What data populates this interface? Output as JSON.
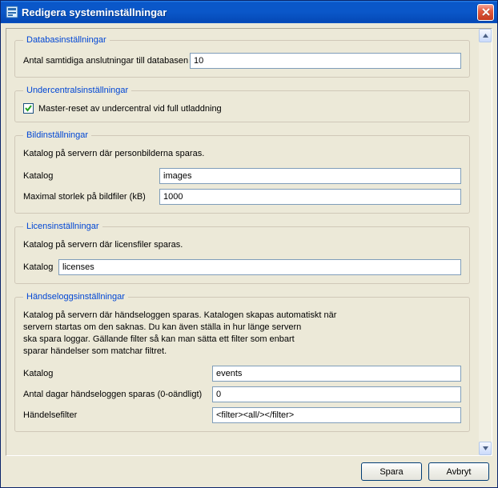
{
  "window": {
    "title": "Redigera systeminställningar"
  },
  "groups": {
    "database": {
      "legend": "Databasinställningar",
      "conn_label": "Antal samtidiga anslutningar till databasen",
      "conn_value": "10"
    },
    "undercentral": {
      "legend": "Undercentralsinställningar",
      "master_reset_label": "Master-reset av undercentral vid full utladdning",
      "master_reset_checked": true
    },
    "images": {
      "legend": "Bildinställningar",
      "desc": "Katalog på servern där personbilderna sparas.",
      "dir_label": "Katalog",
      "dir_value": "images",
      "maxsize_label": "Maximal storlek på bildfiler (kB)",
      "maxsize_value": "1000"
    },
    "license": {
      "legend": "Licensinställningar",
      "desc": "Katalog på servern där licensfiler sparas.",
      "dir_label": "Katalog",
      "dir_value": "licenses"
    },
    "eventlog": {
      "legend": "Händseloggsinställningar",
      "desc": "Katalog på servern där händseloggen sparas. Katalogen skapas automatiskt när\nservern startas om den saknas. Du kan även ställa in hur länge servern\nska spara loggar. Gällande filter så kan man sätta ett filter som enbart\nsparar händelser som matchar filtret.",
      "dir_label": "Katalog",
      "dir_value": "events",
      "days_label": "Antal dagar händseloggen sparas (0-oändligt)",
      "days_value": "0",
      "filter_label": "Händelsefilter",
      "filter_value": "<filter><all/></filter>"
    }
  },
  "buttons": {
    "save": "Spara",
    "cancel": "Avbryt"
  }
}
